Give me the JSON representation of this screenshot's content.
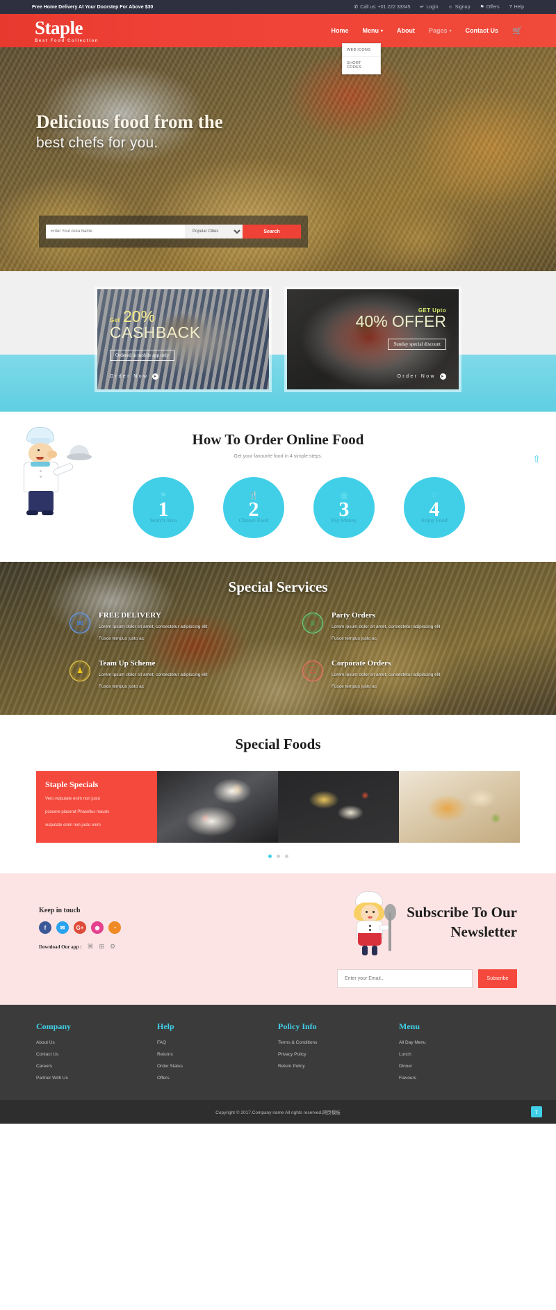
{
  "topbar": {
    "promo": "Free Home Delivery At Your Doorstep For Above $30",
    "items": [
      {
        "label": "Call us: +01 222 33345",
        "icon": "phone-icon",
        "glyph": "✆"
      },
      {
        "label": "Login",
        "icon": "login-icon",
        "glyph": "↵"
      },
      {
        "label": "Signup",
        "icon": "signup-icon",
        "glyph": "☺"
      },
      {
        "label": "Offers",
        "icon": "gift-icon",
        "glyph": "⚑"
      },
      {
        "label": "Help",
        "icon": "help-icon",
        "glyph": "?"
      }
    ]
  },
  "brand": {
    "name": "Staple",
    "tagline": "Best Food Collection"
  },
  "nav": {
    "items": [
      {
        "label": "Home",
        "has_caret": false,
        "active": true
      },
      {
        "label": "Menu",
        "has_caret": true,
        "active": true
      },
      {
        "label": "About",
        "has_caret": false,
        "active": true
      },
      {
        "label": "Pages",
        "has_caret": true,
        "active": false
      },
      {
        "label": "Contact Us",
        "has_caret": false,
        "active": true
      }
    ],
    "cart_icon": "shopping-cart-icon",
    "caret_glyph": "▾",
    "dropdown": {
      "items": [
        "WEB ICONS",
        "SHORT CODES"
      ]
    }
  },
  "hero": {
    "heading_line1": "Delicious food from the",
    "heading_line2": "best chefs for you.",
    "search": {
      "placeholder": "Enter Your Area Name",
      "selected_city": "Popular Cities",
      "button": "Search"
    }
  },
  "offers": [
    {
      "pre_label": "Get",
      "amount": "20%",
      "big_label": "CASHBACK",
      "tag": "Ordered in mobile app only",
      "cta": "Order Now",
      "cta_icon": "arrow-right-circle-icon",
      "align": "left"
    },
    {
      "pre_label": "GET Upto",
      "amount": "40% OFFER",
      "big_label": "",
      "tag": "Sunday special discount",
      "cta": "Order Now",
      "cta_icon": "arrow-right-circle-icon",
      "align": "right"
    }
  ],
  "howto": {
    "title": "How To Order Online Food",
    "subtitle": "Get your favourite food in 4 simple steps.",
    "steps": [
      {
        "number": "1",
        "label": "Search Area",
        "icon": "map-icon"
      },
      {
        "number": "2",
        "label": "Choose Food",
        "icon": "cutlery-icon"
      },
      {
        "number": "3",
        "label": "Pay Money",
        "icon": "card-icon"
      },
      {
        "number": "4",
        "label": "Enjoy Food",
        "icon": "smile-icon"
      }
    ]
  },
  "services": {
    "title": "Special Services",
    "items": [
      {
        "title": "FREE DELIVERY",
        "line1": "Lorem ipsum dolor sit amet, consectetur adipiscing elit",
        "line2": "Fusce tempus justo ac",
        "icon": "truck-icon",
        "ring": "ring-blue",
        "glyph": "✉"
      },
      {
        "title": "Party Orders",
        "line1": "Lorem ipsum dolor sit amet, consectetur adipiscing elit",
        "line2": "Fusce tempus justo ac",
        "icon": "birthday-cake-icon",
        "ring": "ring-green",
        "glyph": "♕"
      },
      {
        "title": "Team Up Scheme",
        "line1": "Lorem ipsum dolor sit amet, consectetur adipiscing elit",
        "line2": "Fusce tempus justo ac",
        "icon": "users-icon",
        "ring": "ring-yellow",
        "glyph": "♟"
      },
      {
        "title": "Corporate Orders",
        "line1": "Lorem ipsum dolor sit amet, consectetur adipiscing elit",
        "line2": "Fusce tempus justo ac",
        "icon": "building-icon",
        "ring": "ring-red",
        "glyph": "☷"
      }
    ]
  },
  "foods": {
    "title": "Special Foods",
    "promo": {
      "heading": "Staple Specials",
      "line1": "Vero vulputate enim non justo",
      "line2": "posuere placerat Phasellus mauris",
      "line3": "vulputate enim non justo enim"
    },
    "carousel_dots": 3,
    "active_dot": 0
  },
  "newsletter": {
    "keep_in_touch": "Keep in touch",
    "socials": [
      {
        "name": "facebook-icon",
        "glyph": "f",
        "class": "s-fb"
      },
      {
        "name": "twitter-icon",
        "glyph": "✉",
        "class": "s-tw"
      },
      {
        "name": "google-plus-icon",
        "glyph": "G+",
        "class": "s-gp"
      },
      {
        "name": "instagram-icon",
        "glyph": "◉",
        "class": "s-ins"
      },
      {
        "name": "rss-icon",
        "glyph": "◔",
        "class": "s-rss"
      }
    ],
    "download_label": "Download Our app :",
    "store_icons": [
      {
        "name": "apple-icon",
        "glyph": "⌘"
      },
      {
        "name": "windows-icon",
        "glyph": "⊞"
      },
      {
        "name": "android-icon",
        "glyph": "⚙"
      }
    ],
    "title_line1": "Subscribe To Our",
    "title_line2": "Newsletter",
    "email_placeholder": "Enter your Email..",
    "subscribe_label": "Subscribe"
  },
  "footer": {
    "columns": [
      {
        "title": "Company",
        "links": [
          "About Us",
          "Contact Us",
          "Careers",
          "Partner With Us"
        ]
      },
      {
        "title": "Help",
        "links": [
          "FAQ",
          "Returns",
          "Order Status",
          "Offers"
        ]
      },
      {
        "title": "Policy Info",
        "links": [
          "Terms & Conditions",
          "Privacy Policy",
          "Return Policy"
        ]
      },
      {
        "title": "Menu",
        "links": [
          "All Day Menu",
          "Lunch",
          "Dinner",
          "Flavours"
        ]
      }
    ],
    "copyright": "Copyright © 2017.Company name All rights reserved.网页模板",
    "back_to_top_icon": "arrow-up-icon"
  },
  "colors": {
    "brand_red": "#ef4136",
    "aqua": "#41cfe8",
    "dark": "#2e3040"
  }
}
